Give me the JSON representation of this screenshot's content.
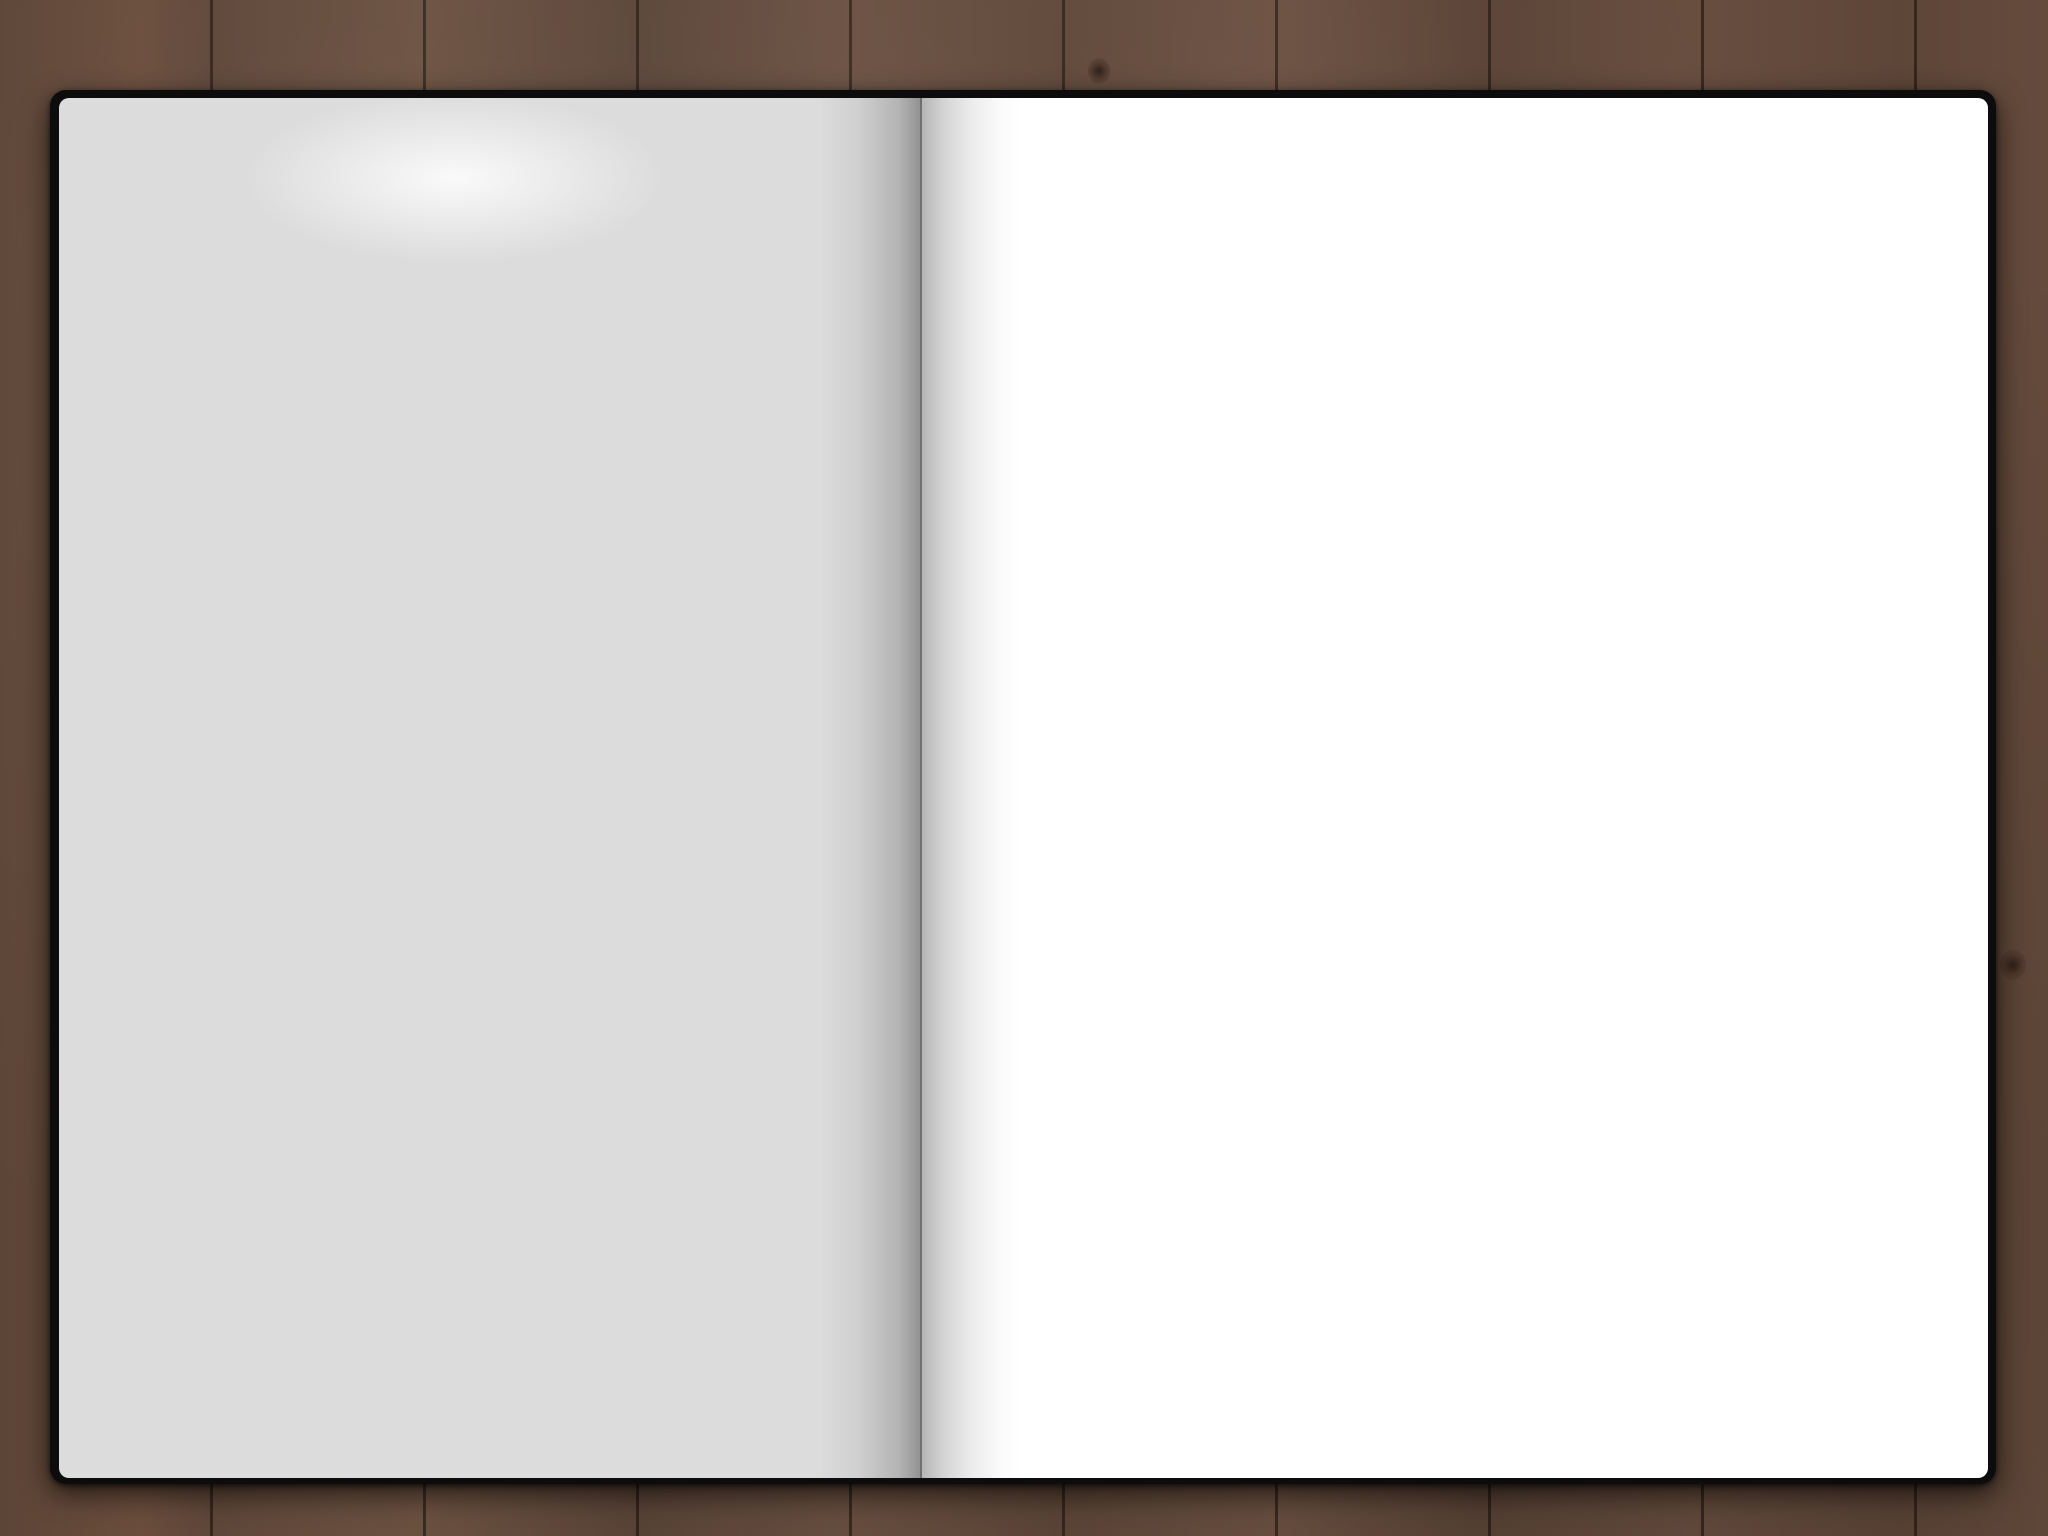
{
  "scene": {
    "background": "wooden-desk",
    "object": "open-blank-notebook"
  },
  "colors": {
    "wood": "#5f4739",
    "cover": "#0c0c0c",
    "left_page": "#dcdcdc",
    "right_page": "#ffffff",
    "spine": "#6f6f6f"
  },
  "pages": {
    "left": {
      "text": ""
    },
    "right": {
      "text": ""
    }
  }
}
